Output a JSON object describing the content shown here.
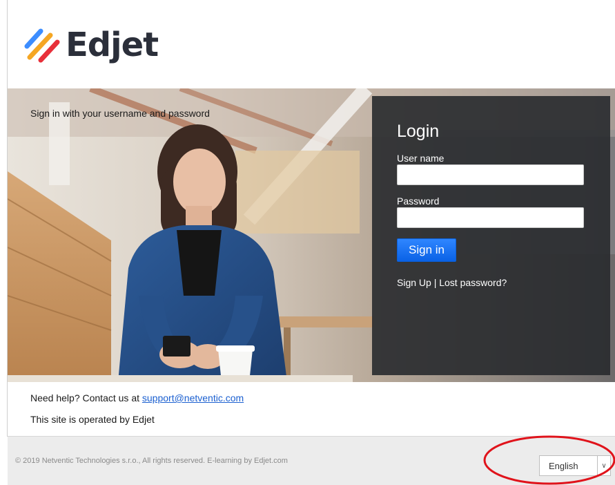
{
  "brand": {
    "name": "Edjet",
    "stripe_colors": [
      "#3c8dff",
      "#f5a623",
      "#e8303a"
    ]
  },
  "hero": {
    "caption": "Sign in with your username and password"
  },
  "login": {
    "title": "Login",
    "username_label": "User name",
    "username_value": "",
    "password_label": "Password",
    "password_value": "",
    "submit_label": "Sign in",
    "signup_label": "Sign Up",
    "separator": " | ",
    "lost_password_label": "Lost password?"
  },
  "help": {
    "prefix": "Need help? Contact us at ",
    "email": "support@netventic.com",
    "operated_by": "This site is operated by Edjet"
  },
  "footer": {
    "copyright": "© 2019 Netventic Technologies s.r.o., All rights reserved. E-learning by Edjet.com",
    "language": {
      "selected": "English"
    }
  },
  "colors": {
    "accent": "#0a62e6",
    "panel": "#282a2e",
    "link": "#1a5fd0",
    "annotation": "#e0131b"
  }
}
